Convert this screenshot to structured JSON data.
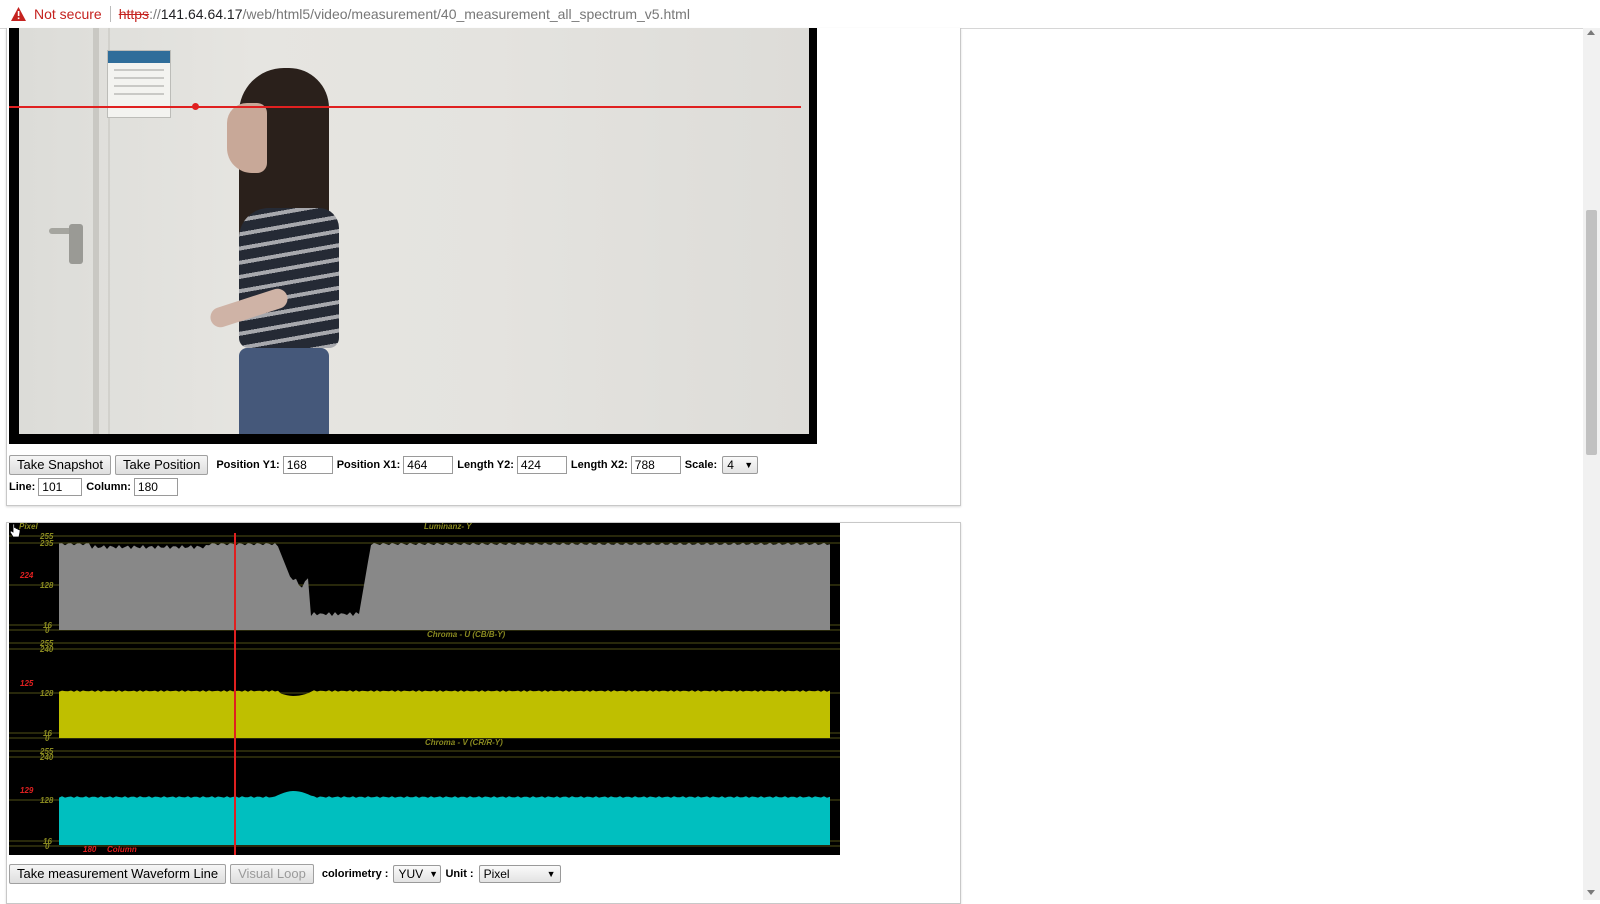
{
  "browser": {
    "security_label": "Not secure",
    "url_protocol": "https",
    "url_separator": "://",
    "url_host": "141.64.64.17",
    "url_path": "/web/html5/video/measurement/40_measurement_all_spectrum_v5.html"
  },
  "video_controls": {
    "take_snapshot_label": "Take Snapshot",
    "take_position_label": "Take Position",
    "position_y1_label": "Position Y1:",
    "position_y1_value": "168",
    "position_x1_label": "Position X1:",
    "position_x1_value": "464",
    "length_y2_label": "Length Y2:",
    "length_y2_value": "424",
    "length_x2_label": "Length X2:",
    "length_x2_value": "788",
    "scale_label": "Scale:",
    "scale_value": "4",
    "line_label": "Line:",
    "line_value": "101",
    "column_label": "Column:",
    "column_value": "180"
  },
  "waveform": {
    "unit_label": "Pixel",
    "luma_title": "Luminanz- Y",
    "chroma_u_title": "Chroma - U (CB/B-Y)",
    "chroma_v_title": "Chroma - V (CR/R-Y)",
    "axis_255": "255",
    "axis_240": "240",
    "axis_235": "235",
    "axis_128": "128",
    "axis_16": "16",
    "axis_0": "0",
    "luma_current": "224",
    "u_current": "125",
    "v_current": "129",
    "column_value": "180",
    "column_label": "Column",
    "colors": {
      "luma_fill": "#888888",
      "u_fill": "#bfbf00",
      "v_fill": "#00bfbf",
      "cursor": "#e02020",
      "grid": "#6b6b1e"
    }
  },
  "wave_controls": {
    "take_waveform_label": "Take measurement Waveform Line",
    "visual_loop_label": "Visual Loop",
    "colorimetry_label": "colorimetry :",
    "colorimetry_value": "YUV",
    "unit_label": "Unit :",
    "unit_value": "Pixel"
  },
  "icons": {
    "warning": "warning-triangle-icon",
    "select_arrow": "▼"
  }
}
